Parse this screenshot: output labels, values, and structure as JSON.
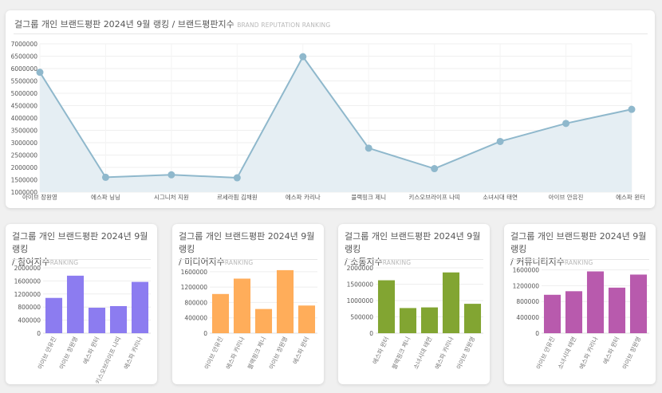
{
  "main": {
    "title": "걸그룹 개인 브랜드평판 2024년 9월 랭킹 / 브랜드평판지수",
    "subtitle": "BRAND REPUTATION RANKING",
    "chart_data": {
      "type": "area",
      "categories": [
        "아이브 장원영",
        "에스파 닝닝",
        "시그니처 지원",
        "르세라핌 김채원",
        "에스파 카리나",
        "블랙핑크 제니",
        "키스오브라이프 나띠",
        "소녀시대 태연",
        "아이브 안유진",
        "에스파 윈터"
      ],
      "values": [
        5850000,
        1600000,
        1700000,
        1580000,
        6480000,
        2780000,
        1950000,
        3050000,
        3780000,
        4350000
      ],
      "yticks": [
        1000000,
        1500000,
        2000000,
        2500000,
        3000000,
        3500000,
        4000000,
        4500000,
        5000000,
        5500000,
        6000000,
        6500000,
        7000000
      ],
      "ylim": [
        1000000,
        7000000
      ],
      "color": "#8fb8cc",
      "fill": "#e5eef3"
    }
  },
  "small": [
    {
      "title_line1": "걸그룹 개인 브랜드평판 2024년 9월 랭킹",
      "title_line2": "/ 참여지수",
      "subtitle": "RANKING",
      "chart_data": {
        "type": "bar",
        "categories": [
          "아이브 안유진",
          "아이브 장원영",
          "에스파 윈터",
          "키스오브라이프 나띠",
          "에스파 카리나"
        ],
        "values": [
          1080000,
          1760000,
          780000,
          830000,
          1570000
        ],
        "yticks": [
          0,
          400000,
          800000,
          1200000,
          1600000,
          2000000
        ],
        "ylim": [
          0,
          2000000
        ],
        "color": "#8c7cf0"
      }
    },
    {
      "title_line1": "걸그룹 개인 브랜드평판 2024년 9월 랭킹",
      "title_line2": "/ 미디어지수",
      "subtitle": "RANKING",
      "chart_data": {
        "type": "bar",
        "categories": [
          "아이브 안유진",
          "에스파 카리나",
          "블랙핑크 제니",
          "아이브 장원영",
          "에스파 윈터"
        ],
        "values": [
          1020000,
          1420000,
          630000,
          1640000,
          720000
        ],
        "yticks": [
          0,
          400000,
          800000,
          1200000,
          1600000
        ],
        "ylim": [
          0,
          1700000
        ],
        "color": "#ffad5a"
      }
    },
    {
      "title_line1": "걸그룹 개인 브랜드평판 2024년 9월 랭킹",
      "title_line2": "/ 소통지수",
      "subtitle": "RANKING",
      "chart_data": {
        "type": "bar",
        "categories": [
          "에스파 윈터",
          "블랙핑크 제니",
          "소녀시대 태연",
          "에스파 카리나",
          "아이브 장원영"
        ],
        "values": [
          1620000,
          770000,
          790000,
          1860000,
          900000
        ],
        "yticks": [
          0,
          500000,
          1000000,
          1500000,
          2000000
        ],
        "ylim": [
          0,
          2000000
        ],
        "color": "#82a532"
      }
    },
    {
      "title_line1": "걸그룹 개인 브랜드평판 2024년 9월 랭킹",
      "title_line2": "/ 커뮤니티지수",
      "subtitle": "RANKING",
      "chart_data": {
        "type": "bar",
        "categories": [
          "아이브 안유진",
          "소녀시대 태연",
          "에스파 카리나",
          "에스파 윈터",
          "아이브 장원영"
        ],
        "values": [
          970000,
          1060000,
          1560000,
          1150000,
          1480000
        ],
        "yticks": [
          0,
          400000,
          800000,
          1200000,
          1600000
        ],
        "ylim": [
          0,
          1650000
        ],
        "color": "#b85aad"
      }
    }
  ]
}
